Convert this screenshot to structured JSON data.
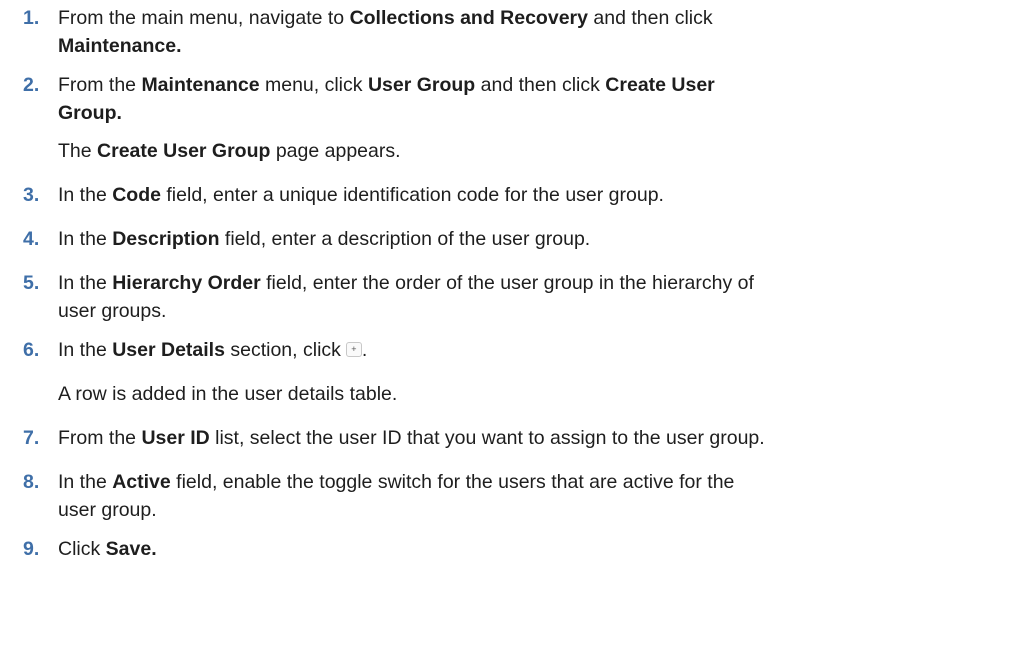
{
  "steps": [
    {
      "num": "1.",
      "t1": "From the main menu, navigate to ",
      "b1": "Collections and Recovery",
      "t2": " and then click ",
      "line2_bold": "Maintenance."
    },
    {
      "num": "2.",
      "t1": "From the ",
      "b1": "Maintenance",
      "t2": " menu, click ",
      "b2": "User Group",
      "t3": " and then click ",
      "b3": "Create User",
      "line2_bold": "Group."
    },
    {
      "note_t1": "The ",
      "note_b1": "Create User Group",
      "note_t2": " page appears."
    },
    {
      "num": "3.",
      "t1": "In the ",
      "b1": "Code",
      "t2": " field, enter a unique identification code for the user group."
    },
    {
      "num": "4.",
      "t1": "In the ",
      "b1": "Description",
      "t2": " field, enter a description of the user group."
    },
    {
      "num": "5.",
      "t1": "In the ",
      "b1": "Hierarchy Order",
      "t2": " field, enter the order of the user group in the hierarchy of",
      "line2": "user groups."
    },
    {
      "num": "6.",
      "t1": "In the ",
      "b1": "User Details",
      "t2": " section, click",
      "icon": "add-row-icon",
      "icon_glyph": "+",
      "t3": "."
    },
    {
      "note": "A row is added in the user details table."
    },
    {
      "num": "7.",
      "t1": "From the ",
      "b1": "User ID",
      "t2": " list, select the user ID that you want to assign to the user group."
    },
    {
      "num": "8.",
      "t1": "In the ",
      "b1": "Active",
      "t2": " field, enable the toggle switch for the users that are active for the",
      "line2": "user group."
    },
    {
      "num": "9.",
      "t1": "Click ",
      "b1": "Save."
    }
  ],
  "colors": {
    "step_number": "#3f6fa8",
    "text": "#1e1e1e"
  }
}
